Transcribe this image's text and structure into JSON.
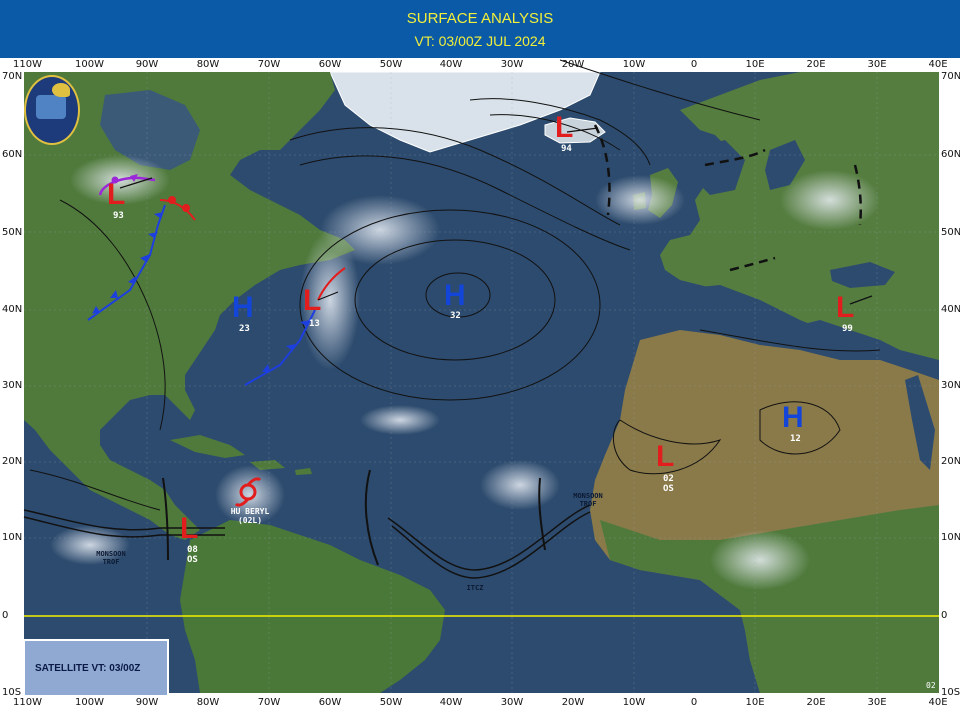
{
  "header": {
    "title": "SURFACE ANALYSIS",
    "valid_time": "VT: 03/00Z JUL 2024"
  },
  "longitude_labels": [
    "110W",
    "100W",
    "90W",
    "80W",
    "70W",
    "60W",
    "50W",
    "40W",
    "30W",
    "20W",
    "10W",
    "0",
    "10E",
    "20E",
    "30E",
    "40E"
  ],
  "latitude_labels": [
    "70N",
    "60N",
    "50N",
    "40N",
    "30N",
    "20N",
    "10N",
    "0",
    "10S"
  ],
  "satellite_box": {
    "label": "SATELLITE VT: 03/00Z"
  },
  "logo": {
    "text": "FLEET WEATHER CENTER NORFOLK"
  },
  "pressure_systems": [
    {
      "type": "L",
      "pressure": "94",
      "color": "#e21d1d"
    },
    {
      "type": "L",
      "pressure": "93",
      "color": "#e21d1d"
    },
    {
      "type": "L",
      "pressure": "13",
      "color": "#e21d1d"
    },
    {
      "type": "H",
      "pressure": "23",
      "color": "#1346d8"
    },
    {
      "type": "H",
      "pressure": "32",
      "color": "#1346d8"
    },
    {
      "type": "L",
      "pressure": "99",
      "color": "#e21d1d"
    },
    {
      "type": "H",
      "pressure": "12",
      "color": "#1346d8"
    },
    {
      "type": "L",
      "pressure": "02",
      "detail": "OS",
      "color": "#e21d1d"
    },
    {
      "type": "L",
      "pressure": "08",
      "detail": "OS",
      "color": "#e21d1d"
    }
  ],
  "storm": {
    "name": "HU BERYL",
    "id": "(02L)",
    "color": "#e21d1d"
  },
  "features": {
    "monsoon_west": [
      "MONSOON",
      "TROF"
    ],
    "monsoon_east": [
      "MONSOON",
      "TROF"
    ],
    "itcz": "ITCZ"
  },
  "corner_code": "02",
  "colors": {
    "banner": "#0b5aa8",
    "banner_text": "#f2ef3a",
    "ocean": "#2d4b6e",
    "land": "#4f7a3c",
    "desert": "#8a7a4a",
    "equator": "#f5f000",
    "cold_front": "#1e3fe0",
    "warm_front": "#e21d1d",
    "occluded_front": "#9b27d8"
  }
}
